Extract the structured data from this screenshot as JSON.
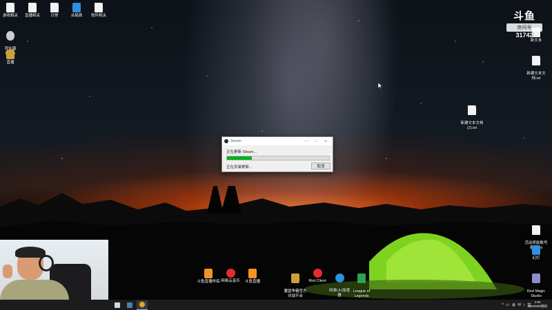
{
  "desktop_icons_top": [
    {
      "label": "游戏相关",
      "icon": "folder-file-icon"
    },
    {
      "label": "直播相关",
      "icon": "folder-file-icon"
    },
    {
      "label": "日常",
      "icon": "folder-file-icon"
    },
    {
      "label": "台局面",
      "icon": "shortcut-icon"
    },
    {
      "label": "软件相关",
      "icon": "folder-file-icon"
    }
  ],
  "desktop_icons_left": [
    {
      "label": "异仙镇\nDemo",
      "icon": "game-icon"
    },
    {
      "label": "直播",
      "icon": "app-icon"
    }
  ],
  "desktop_icons_right": [
    {
      "label": "新文本",
      "icon": "text-file-icon"
    },
    {
      "label": "新建文本文\n档.txt",
      "icon": "text-file-icon"
    },
    {
      "label": "新建文本文档\n(2).txt",
      "icon": "text-file-icon"
    },
    {
      "label": "活动奖励账号\n密码.txt",
      "icon": "text-file-icon"
    },
    {
      "label": "幻灯",
      "icon": "app-icon"
    },
    {
      "label": "Red Magic\nStudio",
      "icon": "app-icon"
    }
  ],
  "desktop_icons_bottom": [
    {
      "label": "斗鱼直播伴侣",
      "icon": "douyu-icon"
    },
    {
      "label": "网易云音乐",
      "icon": "netease-music-icon"
    },
    {
      "label": "斗鱼直播",
      "icon": "douyu-icon"
    },
    {
      "label": "魔兽争霸官方\n对战平台",
      "icon": "warcraft-icon"
    },
    {
      "label": "Riot Client",
      "icon": "riot-icon"
    },
    {
      "label": "网易UU加速\n器",
      "icon": "uu-icon"
    },
    {
      "label": "League of\nLegends",
      "icon": "lol-icon"
    }
  ],
  "watermark": {
    "logo": "斗鱼",
    "room_label": "房间号",
    "room_number": "31742"
  },
  "steam_dialog": {
    "title": "Steam",
    "status": "正在更新 Steam...",
    "progress": 0.24,
    "sub_status": "正在安装更新...",
    "cancel_label": "取消",
    "minimize": "—",
    "maximize": "□",
    "close": "✕"
  },
  "taskbar": {
    "apps": [
      {
        "name": "taskbar-explorer",
        "color": "#cfd8dc"
      },
      {
        "name": "taskbar-steam",
        "color": "#4b7fa8"
      },
      {
        "name": "taskbar-chrome",
        "color": "#e0a52a"
      }
    ],
    "tray_icons": [
      "^",
      "▭",
      "◍",
      "✉",
      "♪",
      "英"
    ],
    "time": "1:02",
    "date": "2022/6/9/周四"
  },
  "colors": {
    "progress": "#06b025",
    "taskbar": "#1c1c1c"
  }
}
